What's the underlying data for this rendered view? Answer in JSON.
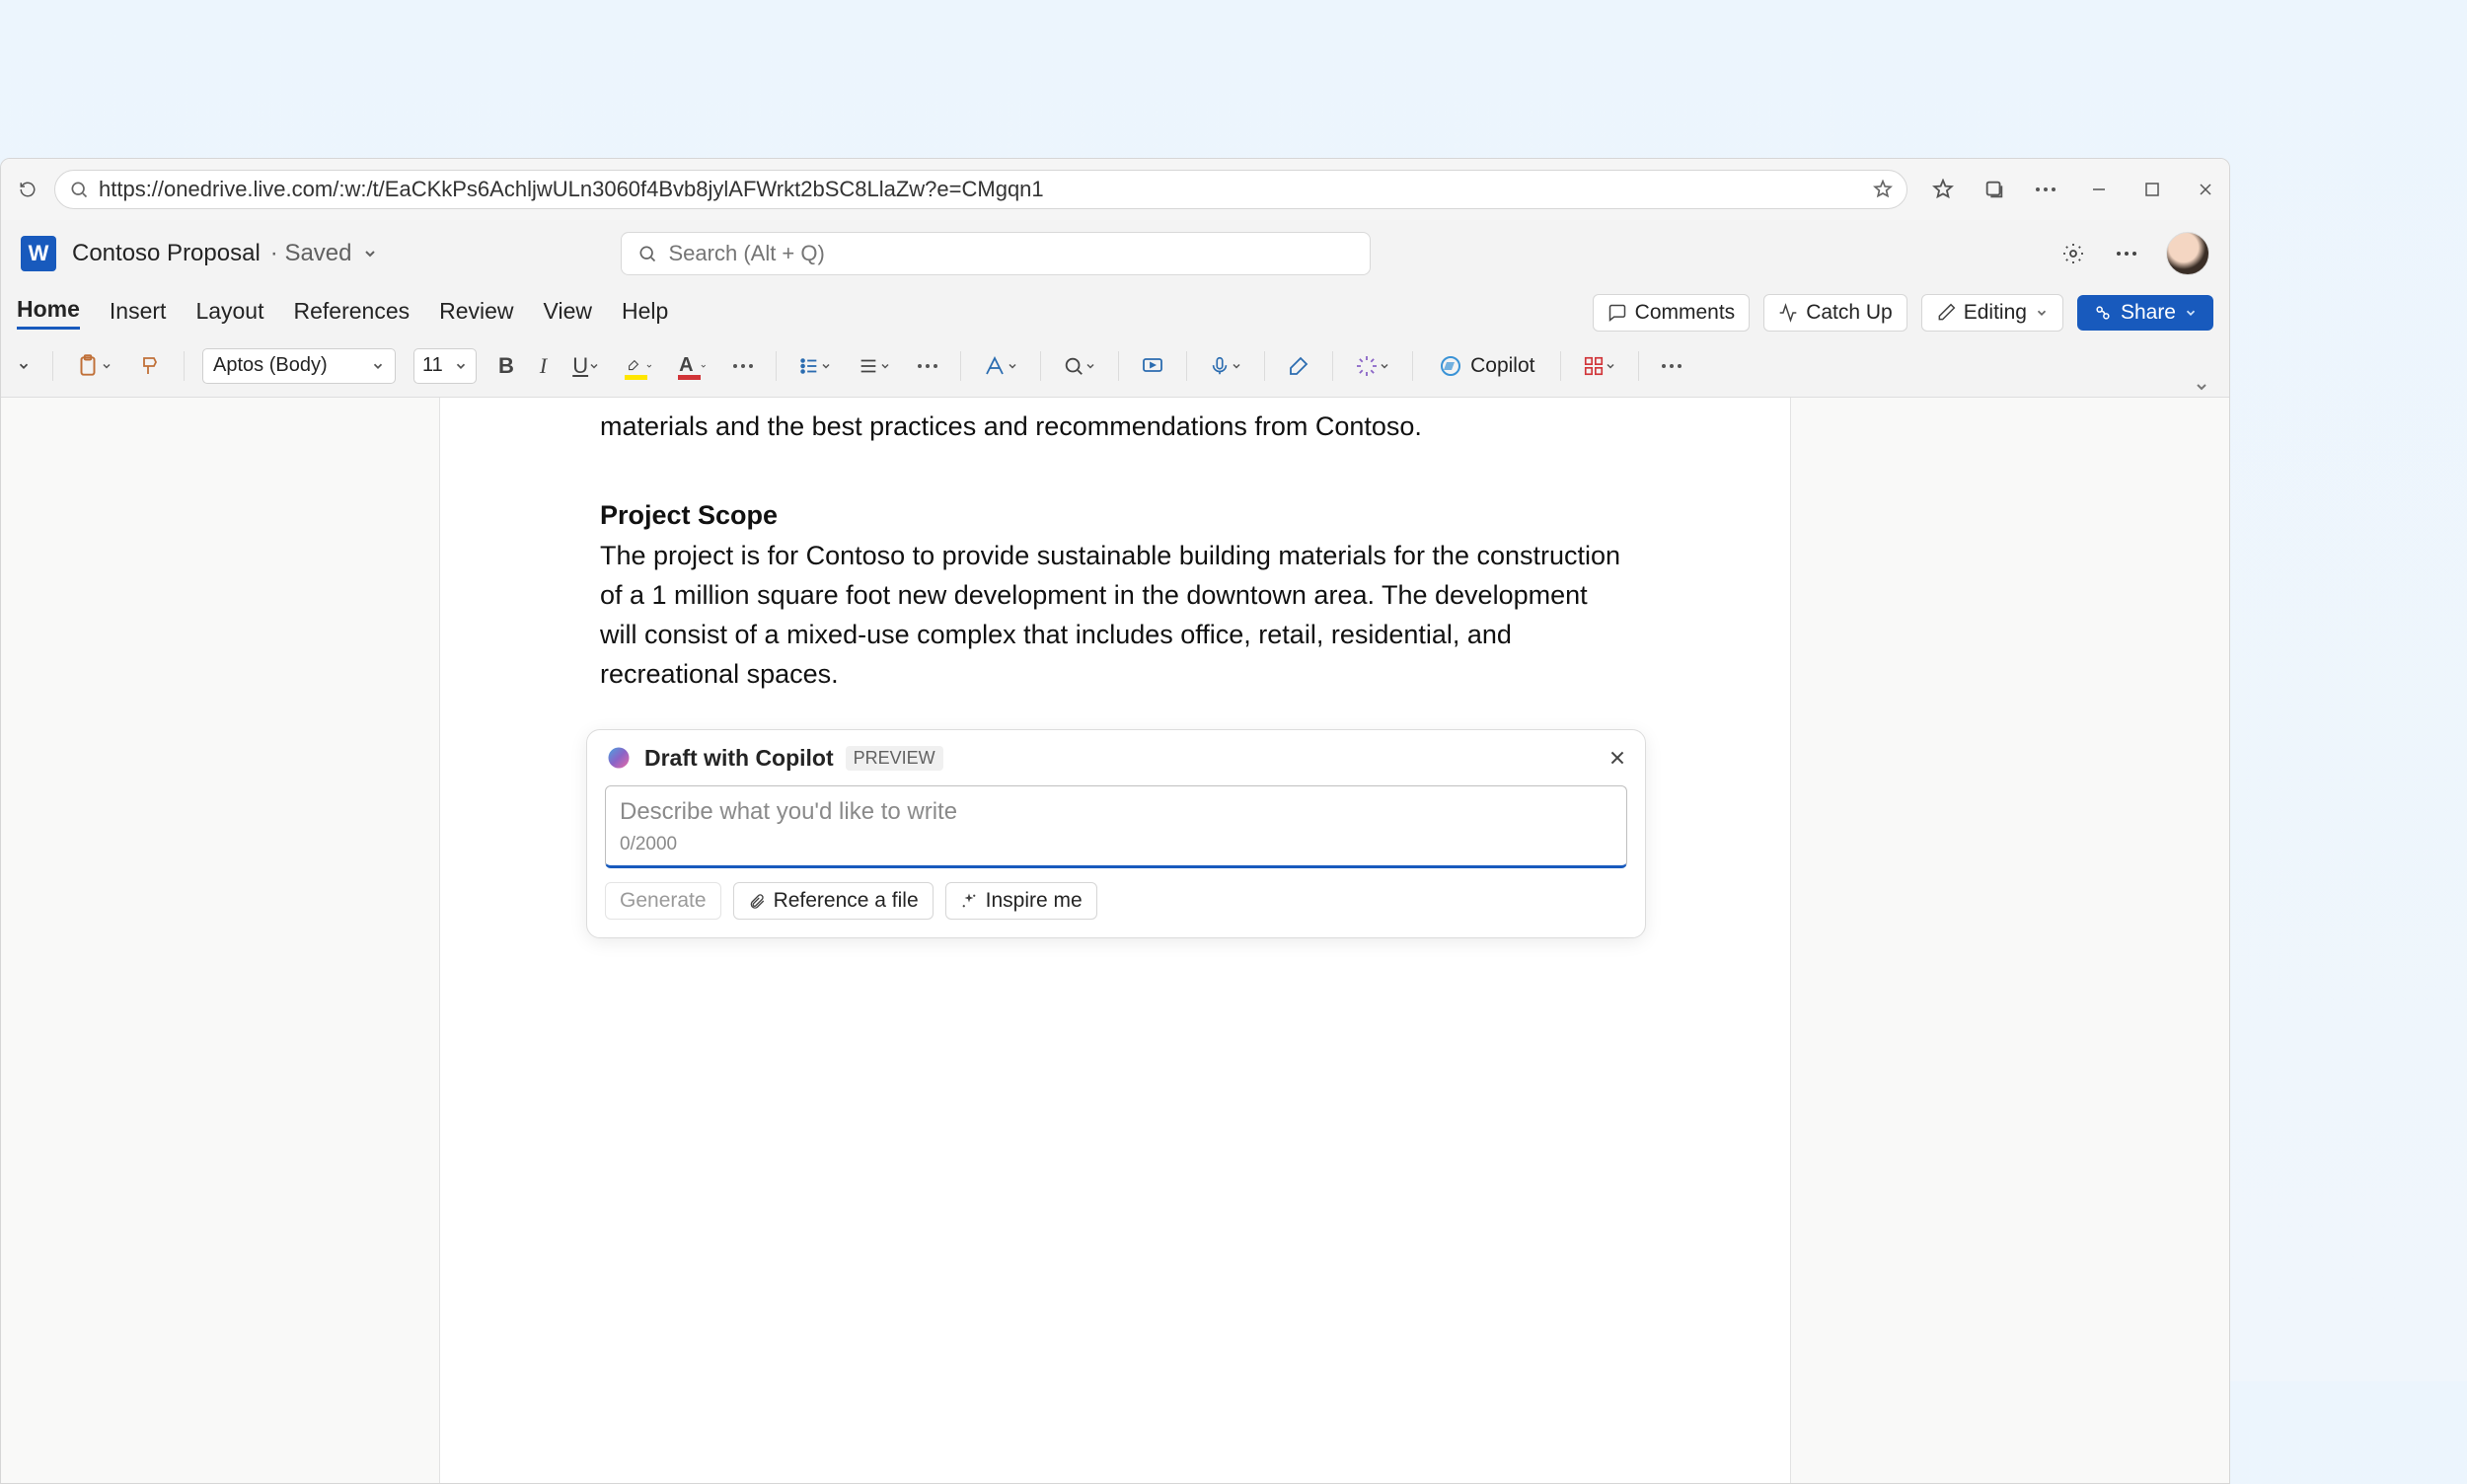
{
  "browser": {
    "url": "https://onedrive.live.com/:w:/t/EaCKkPs6AchljwULn3060f4Bvb8jylAFWrkt2bSC8LlaZw?e=CMgqn1"
  },
  "header": {
    "doc_title": "Contoso Proposal",
    "saved_label": "· Saved",
    "search_placeholder": "Search (Alt + Q)"
  },
  "ribbon": {
    "tabs": [
      "Home",
      "Insert",
      "Layout",
      "References",
      "Review",
      "View",
      "Help"
    ],
    "active_tab": "Home",
    "comments_label": "Comments",
    "catchup_label": "Catch Up",
    "editing_label": "Editing",
    "share_label": "Share"
  },
  "toolbar": {
    "font_name": "Aptos (Body)",
    "font_size": "11",
    "copilot_label": "Copilot"
  },
  "document": {
    "prev_tail": "materials and the best practices and recommendations from Contoso.",
    "scope_heading": "Project Scope",
    "scope_body": "The project is for Contoso to provide sustainable building materials for the construction of a 1 million square foot new development in the downtown area. The development will consist of a mixed-use complex that includes office, retail, residential, and recreational spaces."
  },
  "draft": {
    "title": "Draft with Copilot",
    "preview_badge": "PREVIEW",
    "placeholder": "Describe what you'd like to write",
    "count": "0/2000",
    "generate_label": "Generate",
    "reference_label": "Reference a file",
    "inspire_label": "Inspire me"
  }
}
